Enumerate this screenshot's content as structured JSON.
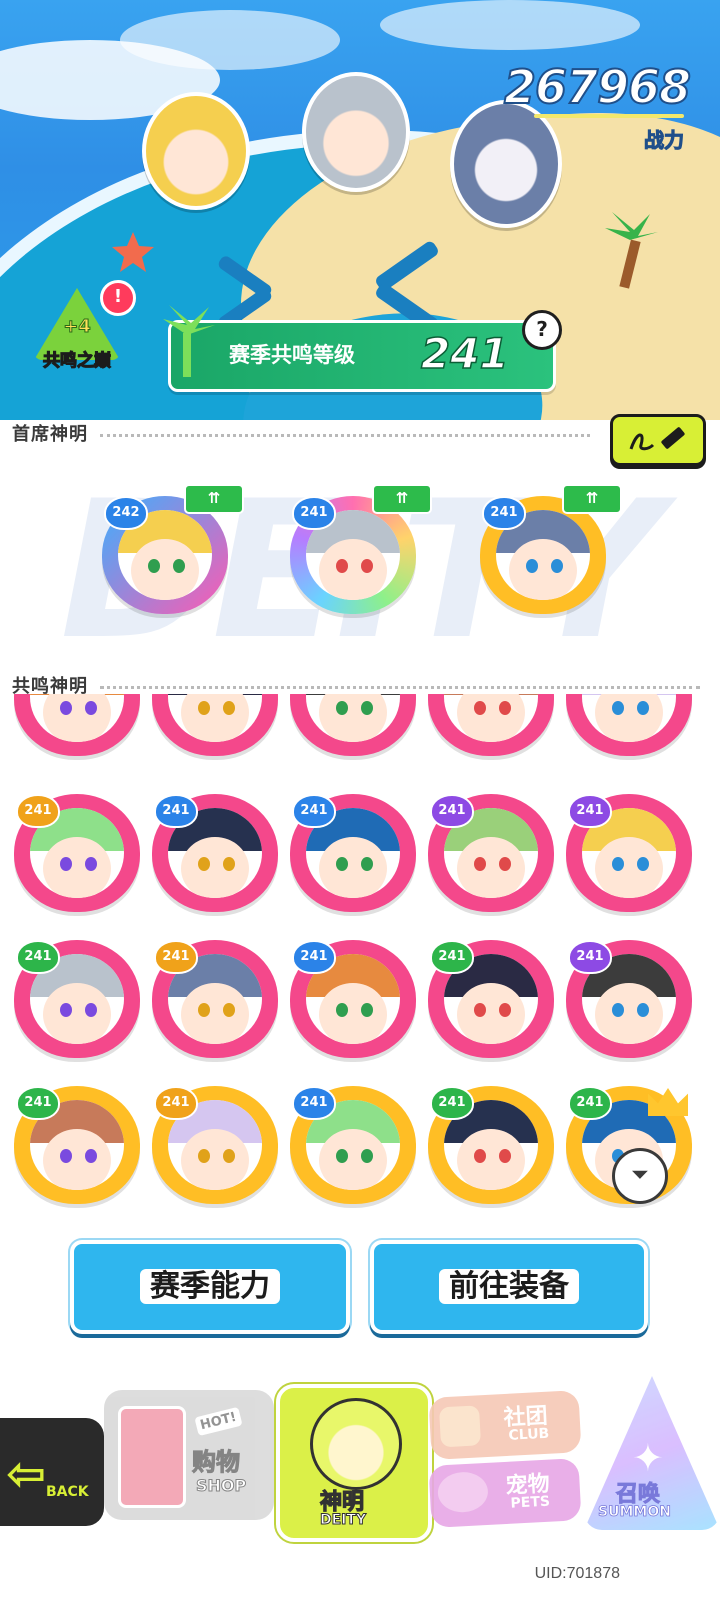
{
  "header": {
    "power_value": "267968",
    "power_label": "战力",
    "peak": {
      "plus": "+4",
      "label": "共鸣之巅"
    },
    "season_label": "赛季共鸣等级",
    "season_level": "241",
    "help_label": "?"
  },
  "sections": {
    "chief": "首席神明",
    "resonance": "共鸣神明"
  },
  "watermark": "DEITY",
  "chief_deities": [
    {
      "level": "242",
      "ring": "bluepink",
      "badge": "blue",
      "up": "⇈"
    },
    {
      "level": "241",
      "ring": "rainbow",
      "badge": "blue",
      "up": "⇈"
    },
    {
      "level": "241",
      "ring": "gold",
      "badge": "blue",
      "up": "⇈"
    }
  ],
  "resonance_rows": [
    [
      {
        "level": "",
        "ring": "pink",
        "badge": "green"
      },
      {
        "level": "",
        "ring": "pink",
        "badge": "blue"
      },
      {
        "level": "",
        "ring": "pink",
        "badge": "blue"
      },
      {
        "level": "",
        "ring": "pink",
        "badge": "purple"
      },
      {
        "level": "",
        "ring": "pink",
        "badge": "green"
      }
    ],
    [
      {
        "level": "241",
        "ring": "pink",
        "badge": "yellow"
      },
      {
        "level": "241",
        "ring": "pink",
        "badge": "blue"
      },
      {
        "level": "241",
        "ring": "pink",
        "badge": "blue"
      },
      {
        "level": "241",
        "ring": "pink",
        "badge": "purple"
      },
      {
        "level": "241",
        "ring": "pink",
        "badge": "purple"
      }
    ],
    [
      {
        "level": "241",
        "ring": "pink",
        "badge": "green"
      },
      {
        "level": "241",
        "ring": "pink",
        "badge": "yellow"
      },
      {
        "level": "241",
        "ring": "pink",
        "badge": "blue"
      },
      {
        "level": "241",
        "ring": "pink",
        "badge": "green"
      },
      {
        "level": "241",
        "ring": "pink",
        "badge": "purple"
      }
    ],
    [
      {
        "level": "241",
        "ring": "gold",
        "badge": "green"
      },
      {
        "level": "241",
        "ring": "gold",
        "badge": "yellow"
      },
      {
        "level": "241",
        "ring": "gold",
        "badge": "blue"
      },
      {
        "level": "241",
        "ring": "gold",
        "badge": "green"
      },
      {
        "level": "241",
        "ring": "gold",
        "badge": "green"
      }
    ]
  ],
  "actions": {
    "season_ability": "赛季能力",
    "go_equip": "前往装备"
  },
  "nav": {
    "back": "BACK",
    "shop_cn": "购物",
    "shop_en": "SHOP",
    "shop_hot": "HOT!",
    "deity_cn": "神明",
    "deity_en": "DEITY",
    "club_cn": "社团",
    "club_en": "CLUB",
    "pets_cn": "宠物",
    "pets_en": "PETS",
    "summon_cn": "召唤",
    "summon_en": "SUMMON"
  },
  "uid": "UID:701878",
  "colors": {
    "sky": "#39a3f0",
    "season_bar": "#1aa667",
    "ring_pink": "#f4488b",
    "ring_gold": "#ffbe25",
    "accent_lime": "#d8ef35",
    "action_blue": "#2fb6ee"
  }
}
